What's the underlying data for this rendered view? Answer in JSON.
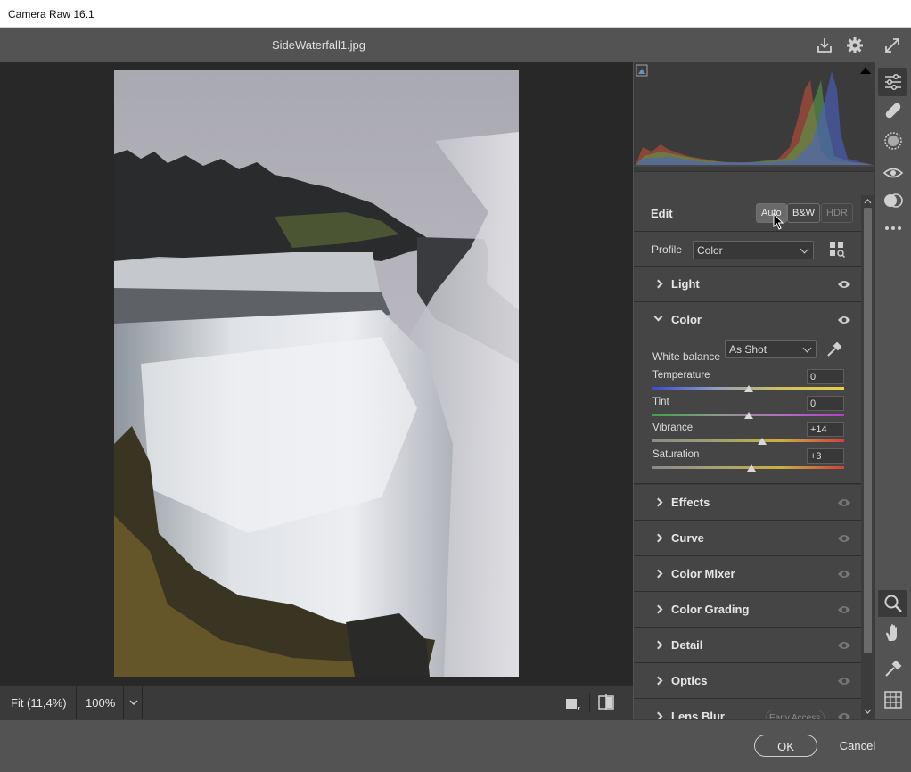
{
  "window": {
    "title": "Camera Raw 16.1"
  },
  "header": {
    "filename": "SideWaterfall1.jpg"
  },
  "edit": {
    "label": "Edit",
    "buttons": {
      "auto": "Auto",
      "bw": "B&W",
      "hdr": "HDR"
    },
    "profile_label": "Profile",
    "profile_value": "Color"
  },
  "sections": {
    "light": "Light",
    "color": "Color",
    "effects": "Effects",
    "curve": "Curve",
    "color_mixer": "Color Mixer",
    "color_grading": "Color Grading",
    "detail": "Detail",
    "optics": "Optics",
    "lens_blur": "Lens Blur",
    "lens_blur_badge": "Early Access"
  },
  "color_panel": {
    "white_balance_label": "White balance",
    "white_balance_value": "As Shot",
    "sliders": [
      {
        "label": "Temperature",
        "value": "0",
        "position": 0.5
      },
      {
        "label": "Tint",
        "value": "0",
        "position": 0.5
      },
      {
        "label": "Vibrance",
        "value": "+14",
        "position": 0.57
      },
      {
        "label": "Saturation",
        "value": "+3",
        "position": 0.515
      }
    ]
  },
  "canvas_bar": {
    "fit": "Fit (11,4%)",
    "zoom": "100%"
  },
  "footer": {
    "ok": "OK",
    "cancel": "Cancel"
  },
  "icons": {
    "header": [
      "save-icon",
      "settings-gear-icon",
      "fullscreen-icon"
    ],
    "tools": [
      "edit-sliders-icon",
      "healing-icon",
      "masking-icon",
      "red-eye-icon",
      "presets-icon",
      "more-icon",
      "zoom-icon",
      "hand-icon",
      "color-sampler-icon",
      "grid-icon"
    ]
  },
  "colors": {
    "accent_panel": "#454545",
    "background": "#535353",
    "canvas": "#282828"
  }
}
